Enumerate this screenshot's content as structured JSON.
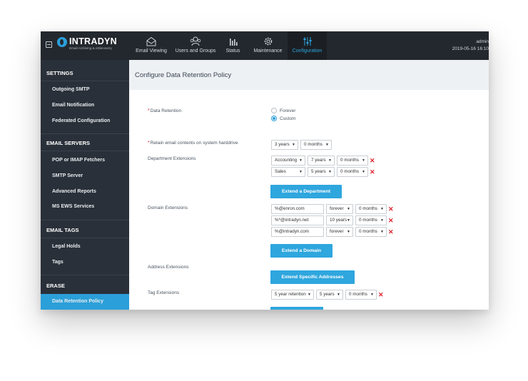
{
  "brand": {
    "name": "INTRADYN",
    "tagline": "Email Archiving & eDiscovery"
  },
  "nav": [
    {
      "label": "Email Viewing",
      "icon": "envelope-icon"
    },
    {
      "label": "Users and Groups",
      "icon": "users-icon"
    },
    {
      "label": "Status",
      "icon": "bar-chart-icon"
    },
    {
      "label": "Maintenance",
      "icon": "gear-icon"
    },
    {
      "label": "Configuration",
      "icon": "sliders-icon",
      "active": true
    }
  ],
  "user": {
    "name": "admin",
    "datetime": "2019-05-16 16:10"
  },
  "sidebar": {
    "sections": [
      {
        "title": "SETTINGS",
        "items": [
          "Outgoing SMTP",
          "Email Notification",
          "Federated Configuration"
        ]
      },
      {
        "title": "EMAIL SERVERS",
        "items": [
          "POP or IMAP Fetchers",
          "SMTP Server",
          "Advanced Reports",
          "MS EWS Services"
        ]
      },
      {
        "title": "EMAIL TAGS",
        "items": [
          "Legal Holds",
          "Tags"
        ]
      },
      {
        "title": "ERASE",
        "items": [
          "Data Retention Policy"
        ]
      }
    ],
    "active_item": "Data Retention Policy"
  },
  "page_title": "Configure Data Retention Policy",
  "form": {
    "data_retention": {
      "label": "Data Retention",
      "options": [
        "Forever",
        "Custom"
      ],
      "selected": "Custom"
    },
    "retain": {
      "label": "Retain email contents on system harddrive",
      "years": "3 years",
      "months": "0 months"
    },
    "department": {
      "label": "Department Extensions",
      "rows": [
        {
          "name": "Accounting",
          "years": "7 years",
          "months": "0 months"
        },
        {
          "name": "Sales",
          "years": "5 years",
          "months": "0 months"
        }
      ],
      "button": "Extend a Department"
    },
    "domain": {
      "label": "Domain Extensions",
      "rows": [
        {
          "domain": "%@enron.com",
          "years": "forever",
          "months": "0 months"
        },
        {
          "domain": "%*@intradyn.net",
          "years": "10 years",
          "months": "0 months"
        },
        {
          "domain": "%@intradyn.com",
          "years": "forever",
          "months": "0 months"
        }
      ],
      "button": "Extend a Domain"
    },
    "address": {
      "label": "Address Extensions",
      "button": "Extend Specific Addresses"
    },
    "tag": {
      "label": "Tag Extensions",
      "rows": [
        {
          "tag": "5 year retention",
          "years": "5 years",
          "months": "0 months"
        }
      ]
    }
  },
  "colors": {
    "accent": "#2ea6de",
    "sidebar": "#2a3039",
    "topbar": "#23282e",
    "remove": "#e0242e"
  }
}
